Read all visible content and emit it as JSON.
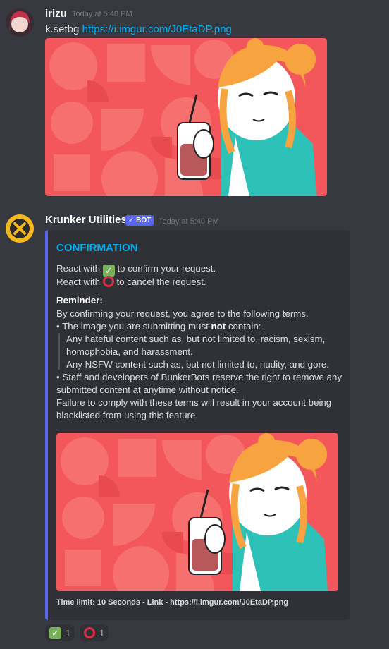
{
  "messages": [
    {
      "username": "irizu",
      "timestamp": "Today at 5:40 PM",
      "command": "k.setbg",
      "link": "https://i.imgur.com/J0EtaDP.png"
    },
    {
      "username": "Krunker Utilities",
      "bot_tag": "✓ BOT",
      "timestamp": "Today at 5:40 PM",
      "embed": {
        "title": "CONFIRMATION",
        "react_confirm_prefix": "React with",
        "react_confirm_suffix": "to confirm your request.",
        "react_cancel_prefix": "React with",
        "react_cancel_suffix": "to cancel the request.",
        "reminder_label": "Reminder:",
        "terms_intro": "By confirming your request, you agree to the following terms.",
        "bullet1_prefix": "• The image you are submitting must",
        "bullet1_bold": "not",
        "bullet1_suffix": "contain:",
        "quote_line1": "Any hateful content such as, but not limited to, racism, sexism,",
        "quote_line2": "homophobia, and harassment.",
        "quote_line3": "Any NSFW content such as, but not limited to, nudity, and gore.",
        "bullet2_line1": "• Staff and developers of BunkerBots reserve the right to remove any",
        "bullet2_line2": "submitted content at anytime without notice.",
        "failure_line1": "Failure to comply with these terms will result in your account being",
        "failure_line2": "blacklisted from using this feature.",
        "footer": "Time limit: 10 Seconds - Link - https://i.imgur.com/J0EtaDP.png"
      }
    }
  ],
  "reactions": [
    {
      "emoji": "white-check-mark",
      "count": "1"
    },
    {
      "emoji": "red-circle",
      "count": "1"
    }
  ],
  "colors": {
    "background": "#36393f",
    "embed_bg": "#2f3136",
    "embed_border": "#5865f2",
    "link": "#00b0f4",
    "art_red": "#f5555a",
    "hair_orange": "#f7a440",
    "jacket_teal": "#2ec1b8"
  }
}
